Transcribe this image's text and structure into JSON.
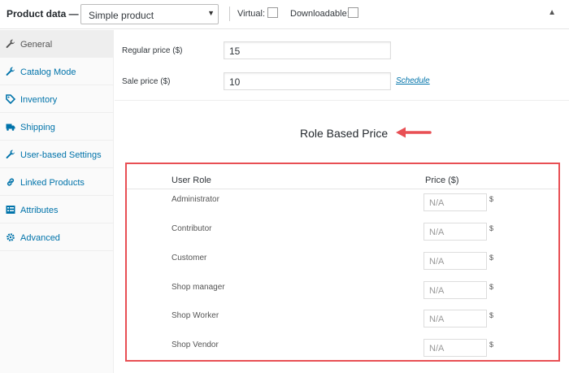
{
  "header": {
    "title": "Product data —",
    "product_type": "Simple product",
    "virtual_label": "Virtual:",
    "downloadable_label": "Downloadable:"
  },
  "sidebar": {
    "items": [
      {
        "label": "General",
        "icon": "wrench-icon",
        "active": true
      },
      {
        "label": "Catalog Mode",
        "icon": "wrench-icon",
        "active": false
      },
      {
        "label": "Inventory",
        "icon": "tag-icon",
        "active": false
      },
      {
        "label": "Shipping",
        "icon": "truck-icon",
        "active": false
      },
      {
        "label": "User-based Settings",
        "icon": "wrench-icon",
        "active": false
      },
      {
        "label": "Linked Products",
        "icon": "link-icon",
        "active": false
      },
      {
        "label": "Attributes",
        "icon": "list-icon",
        "active": false
      },
      {
        "label": "Advanced",
        "icon": "gear-icon",
        "active": false
      }
    ]
  },
  "general": {
    "regular_price_label": "Regular price ($)",
    "regular_price_value": "15",
    "sale_price_label": "Sale price ($)",
    "sale_price_value": "10",
    "schedule_link": "Schedule"
  },
  "role_based_price": {
    "title": "Role Based Price",
    "col_role": "User Role",
    "col_price": "Price ($)",
    "currency": "$",
    "rows": [
      {
        "role": "Administrator",
        "placeholder": "N/A"
      },
      {
        "role": "Contributor",
        "placeholder": "N/A"
      },
      {
        "role": "Customer",
        "placeholder": "N/A"
      },
      {
        "role": "Shop manager",
        "placeholder": "N/A"
      },
      {
        "role": "Shop Worker",
        "placeholder": "N/A"
      },
      {
        "role": "Shop Vendor",
        "placeholder": "N/A"
      }
    ]
  },
  "colors": {
    "link": "#0073aa",
    "highlight": "#e84f54",
    "active_tab_bg": "#eeeeee"
  }
}
